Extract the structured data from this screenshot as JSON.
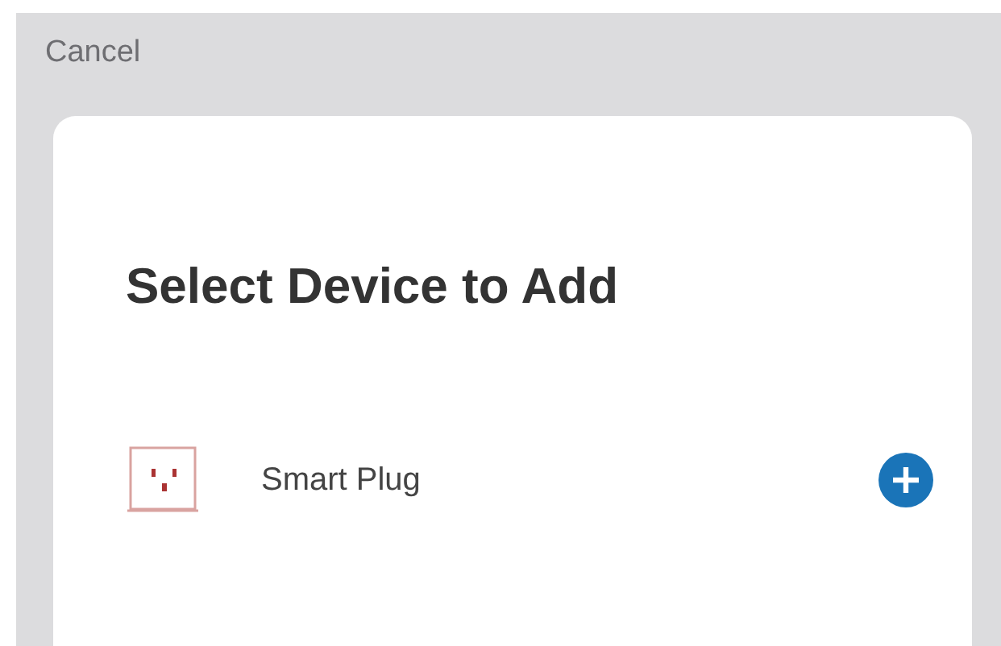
{
  "header": {
    "cancel": "Cancel"
  },
  "sheet": {
    "title": "Select Device to Add",
    "devices": [
      {
        "name": "Smart Plug",
        "kind": "plug"
      }
    ]
  }
}
